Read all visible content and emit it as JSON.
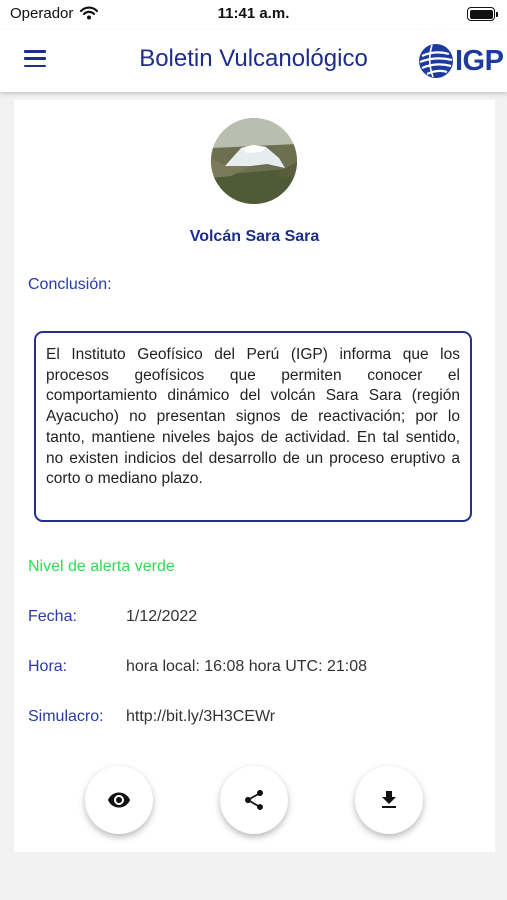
{
  "status_bar": {
    "carrier": "Operador",
    "time": "11:41 a.m."
  },
  "app_bar": {
    "title": "Boletin Vulcanológico",
    "logo_text": "IGP"
  },
  "volcano": {
    "name": "Volcán Sara Sara"
  },
  "conclusion": {
    "label": "Conclusión:",
    "text": "El Instituto Geofísico del Perú (IGP) informa que los procesos geofísicos que permiten conocer el comportamiento dinámico del volcán Sara Sara (región Ayacucho) no presentan signos de reactivación; por lo tanto, mantiene niveles bajos de actividad. En tal sentido, no existen indicios del desarrollo de un proceso eruptivo a corto o mediano plazo."
  },
  "alert": {
    "text": "Nivel de alerta verde"
  },
  "details": {
    "fecha_label": "Fecha:",
    "fecha_value": "1/12/2022",
    "hora_label": "Hora:",
    "hora_value": "hora local: 16:08 hora UTC: 21:08",
    "simulacro_label": "Simulacro:",
    "simulacro_value": "http://bit.ly/3H3CEWr"
  },
  "actions": {
    "view_icon": "eye-icon",
    "share_icon": "share-icon",
    "download_icon": "download-icon"
  },
  "colors": {
    "primary": "#1d2d8a",
    "label": "#2a3aa8",
    "alert_green": "#2edb55"
  }
}
